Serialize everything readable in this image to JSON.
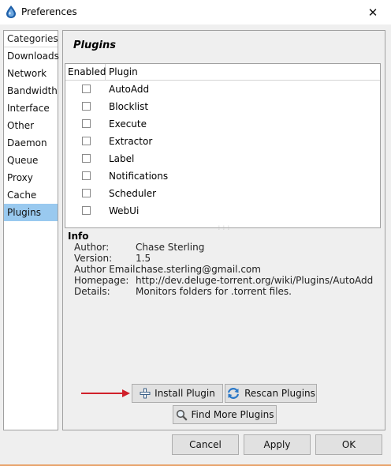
{
  "window": {
    "title": "Preferences"
  },
  "categories": {
    "header": "Categories",
    "items": [
      "Downloads",
      "Network",
      "Bandwidth",
      "Interface",
      "Other",
      "Daemon",
      "Queue",
      "Proxy",
      "Cache",
      "Plugins"
    ],
    "selected": "Plugins"
  },
  "panel": {
    "title": "Plugins"
  },
  "table": {
    "columns": [
      "Enabled",
      "Plugin"
    ],
    "rows": [
      {
        "name": "AutoAdd",
        "enabled": false
      },
      {
        "name": "Blocklist",
        "enabled": false
      },
      {
        "name": "Execute",
        "enabled": false
      },
      {
        "name": "Extractor",
        "enabled": false
      },
      {
        "name": "Label",
        "enabled": false
      },
      {
        "name": "Notifications",
        "enabled": false
      },
      {
        "name": "Scheduler",
        "enabled": false
      },
      {
        "name": "WebUi",
        "enabled": false
      }
    ]
  },
  "info": {
    "title": "Info",
    "fields": [
      {
        "label": "Author:",
        "value": "Chase Sterling"
      },
      {
        "label": "Version:",
        "value": "1.5"
      },
      {
        "label": "Author Email:",
        "value": "chase.sterling@gmail.com"
      },
      {
        "label": "Homepage:",
        "value": "http://dev.deluge-torrent.org/wiki/Plugins/AutoAdd"
      },
      {
        "label": "Details:",
        "value": "Monitors folders for .torrent files."
      }
    ]
  },
  "buttons": {
    "install": "Install Plugin",
    "rescan": "Rescan Plugins",
    "find_more": "Find More Plugins",
    "cancel": "Cancel",
    "apply": "Apply",
    "ok": "OK"
  },
  "icons": {
    "app": "deluge-drop-icon",
    "close": "close-icon",
    "install": "plus-icon",
    "rescan": "refresh-icon",
    "find_more": "magnifier-icon",
    "annotation": "red-arrow-icon"
  },
  "colors": {
    "selection": "#99c9ef",
    "annotation_arrow": "#d0202a",
    "accent_bottom": "#e8a46c"
  }
}
